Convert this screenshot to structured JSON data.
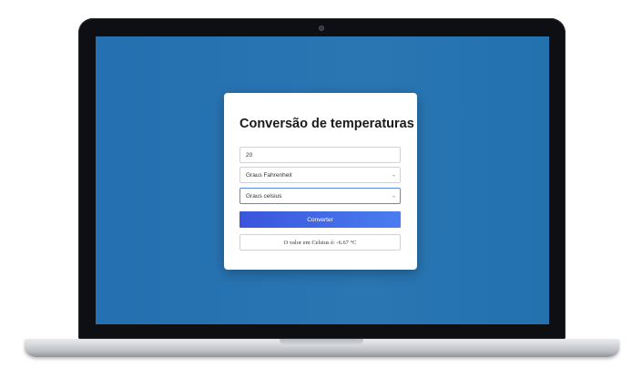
{
  "app": {
    "title": "Conversão de temperaturas"
  },
  "form": {
    "input_value": "20",
    "from_unit": {
      "selected": "Graus Fahrenheit"
    },
    "to_unit": {
      "selected": "Graus celsius"
    },
    "convert_label": "Converter",
    "result_text": "O valor em Celsius é: -6.67 °C"
  },
  "icons": {
    "select_caret": "⌄"
  },
  "colors": {
    "background": "#2470b0",
    "button_start": "#3a55dc",
    "button_end": "#4a7df0",
    "focus_border": "#5a86e8"
  }
}
